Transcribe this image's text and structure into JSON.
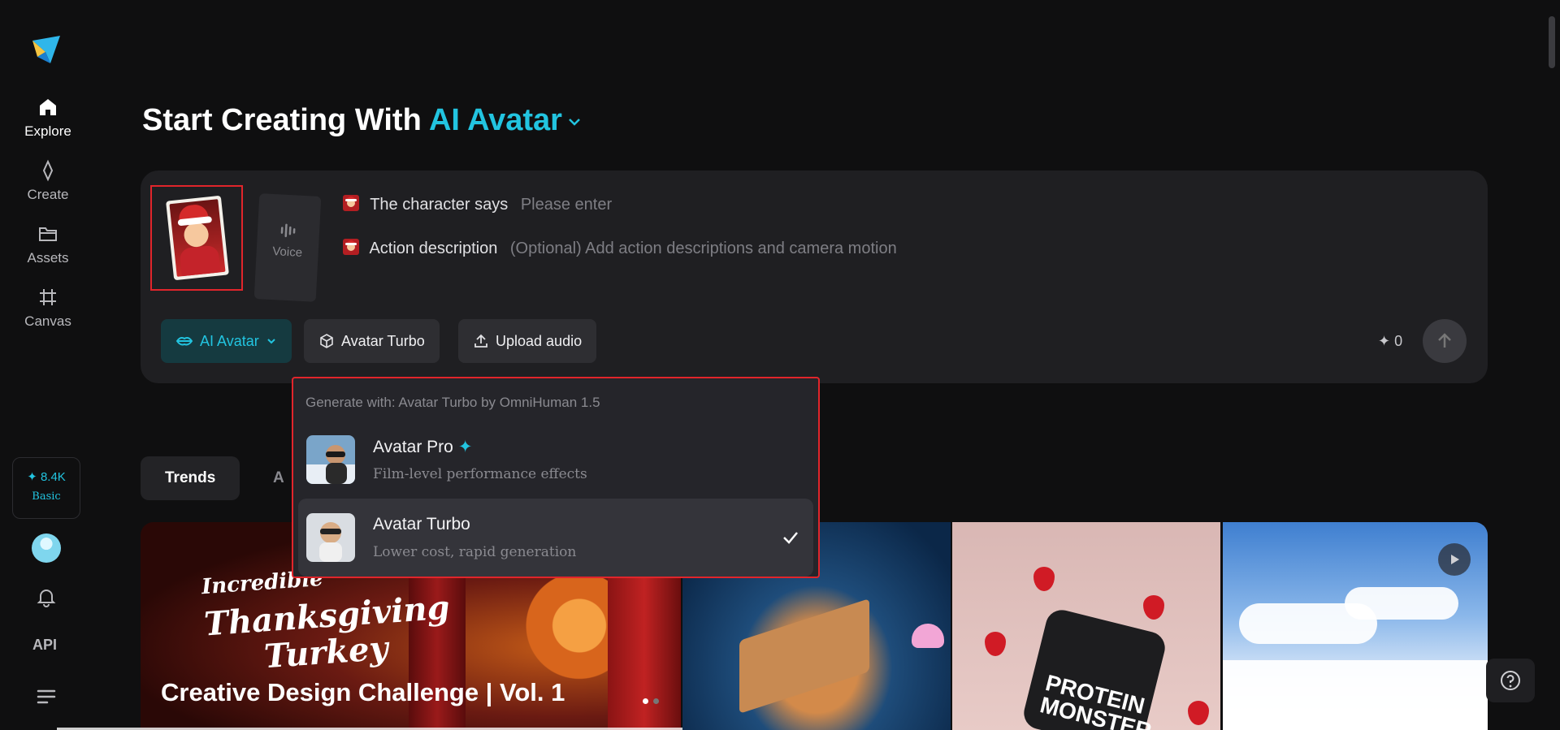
{
  "sidebar": {
    "items": [
      {
        "label": "Explore",
        "icon": "home-icon",
        "active": true
      },
      {
        "label": "Create",
        "icon": "sparkle-diamond-icon",
        "active": false
      },
      {
        "label": "Assets",
        "icon": "folder-icon",
        "active": false
      },
      {
        "label": "Canvas",
        "icon": "canvas-grid-icon",
        "active": false
      }
    ],
    "credits": "✦ 8.4K",
    "tier": "Basic",
    "api_label": "API"
  },
  "header": {
    "title_prefix": "Start Creating With",
    "title_accent": "AI Avatar"
  },
  "composer": {
    "voice_label": "Voice",
    "character_says_label": "The character says",
    "character_says_placeholder": "Please enter",
    "action_label": "Action description",
    "action_placeholder": "(Optional) Add action descriptions and camera motion",
    "mode_chip": "AI Avatar",
    "model_chip": "Avatar Turbo",
    "upload_chip": "Upload audio",
    "cost": "✦ 0"
  },
  "dropdown": {
    "header": "Generate with: Avatar Turbo by OmniHuman 1.5",
    "options": [
      {
        "title": "Avatar Pro",
        "star": "✦",
        "subtitle": "Film-level performance effects",
        "selected": false
      },
      {
        "title": "Avatar Turbo",
        "subtitle": "Lower cost, rapid generation",
        "selected": true
      }
    ]
  },
  "tabs": [
    {
      "label": "Trends",
      "active": true
    },
    {
      "label": "A",
      "active": false
    }
  ],
  "gallery": {
    "promo_line1": "Incredible",
    "promo_line2": "Thanksgiving",
    "promo_line3": "Turkey",
    "card_title": "Creative Design Challenge | Vol. 1",
    "jar_label_1": "PROTEIN",
    "jar_label_2": "MONSTER"
  },
  "colors": {
    "accent": "#22c4e0",
    "highlight_border": "#e1252b",
    "background": "#0f0f10",
    "panel": "#1f1f22"
  }
}
